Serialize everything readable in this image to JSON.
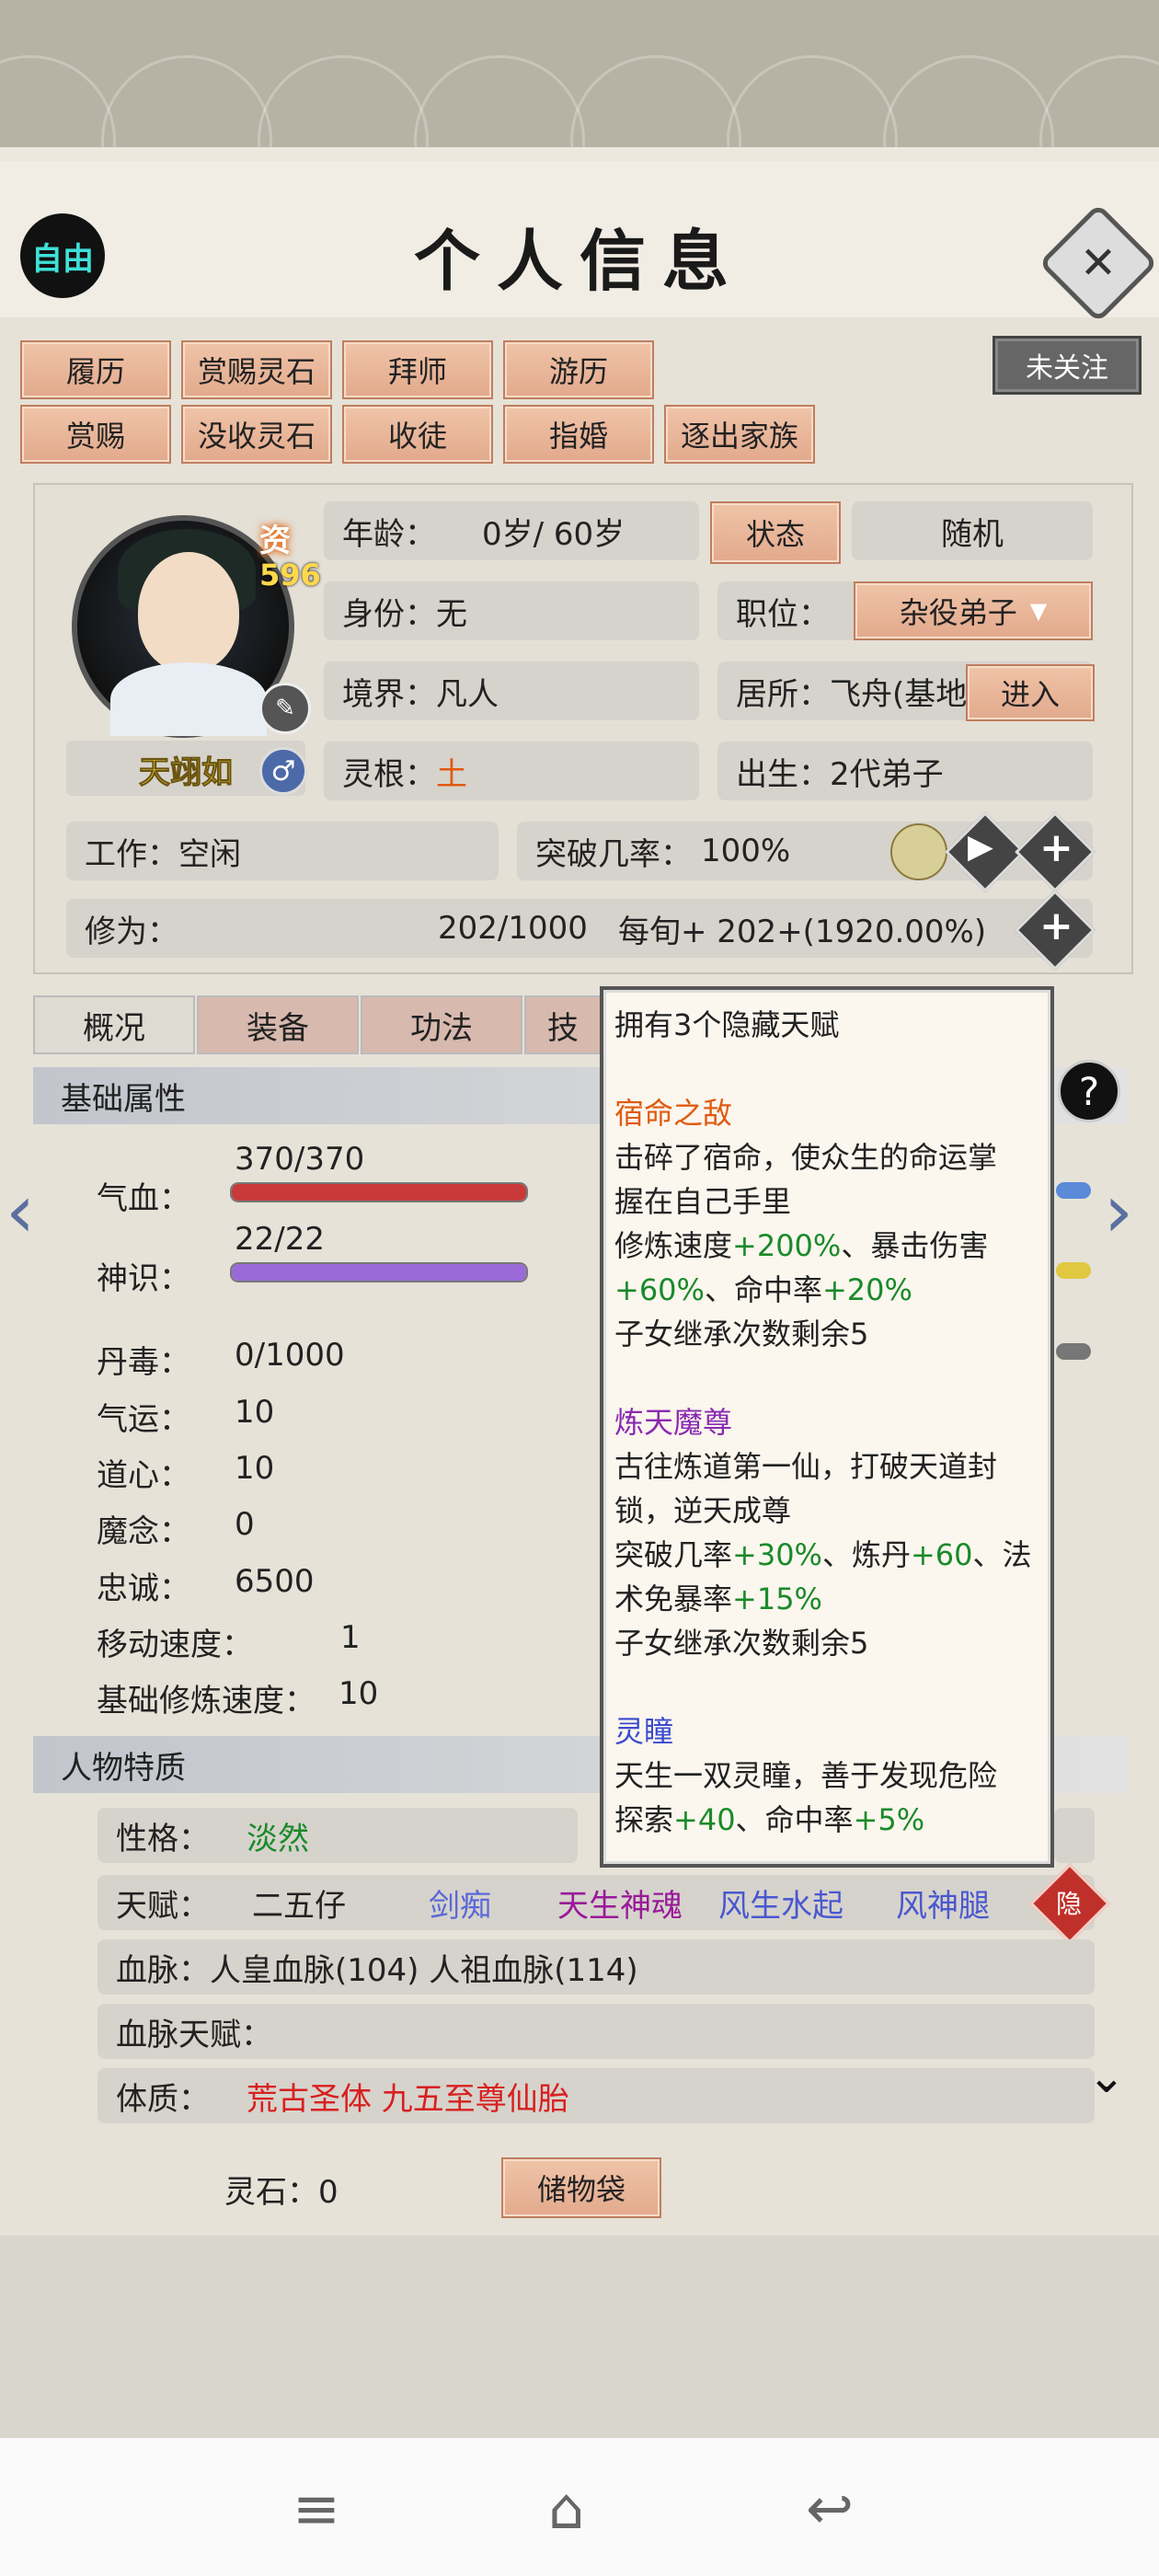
{
  "header": {
    "title": "个人信息",
    "free_badge": "自由",
    "close_icon": "✕"
  },
  "actions_row1": [
    "履历",
    "赏赐灵石",
    "拜师",
    "游历"
  ],
  "actions_row2": [
    "赏赐",
    "没收灵石",
    "收徒",
    "指婚",
    "逐出家族"
  ],
  "follow_button": "未关注",
  "character": {
    "name": "天翊如",
    "aptitude_label": "资",
    "aptitude_value": "596",
    "gender_icon": "♂",
    "age_label": "年龄：",
    "age_value": "0岁/ 60岁",
    "status_button": "状态",
    "random_button": "随机",
    "identity_label": "身份：",
    "identity_value": "无",
    "position_label": "职位：",
    "position_value": "杂役弟子",
    "realm_label": "境界：",
    "realm_value": "凡人",
    "residence_label": "居所：",
    "residence_value": "飞舟(基地",
    "enter_button": "进入",
    "root_label": "灵根：",
    "root_value": "土",
    "birth_label": "出生：",
    "birth_value": "2代弟子",
    "work_label": "工作：",
    "work_value": "空闲",
    "breakthrough_label": "突破几率：",
    "breakthrough_value": "100%",
    "cultivation_label": "修为：",
    "cultivation_value": "202/1000",
    "cultivation_rate": "每旬+   202+(1920.00%)"
  },
  "tabs": [
    "概况",
    "装备",
    "功法",
    "技"
  ],
  "basic": {
    "section_title": "基础属性",
    "hp_label": "气血：",
    "hp_value": "370/370",
    "hp_fraction": 1.0,
    "spirit_label": "神识：",
    "spirit_value": "22/22",
    "spirit_fraction": 1.0,
    "rows": [
      {
        "label": "丹毒：",
        "value": "0/1000"
      },
      {
        "label": "气运：",
        "value": "10"
      },
      {
        "label": "道心：",
        "value": "10"
      },
      {
        "label": "魔念：",
        "value": "0"
      },
      {
        "label": "忠诚：",
        "value": "6500"
      },
      {
        "label": "移动速度：",
        "value": "1"
      },
      {
        "label": "基础修炼速度：",
        "value": "10"
      }
    ]
  },
  "traits": {
    "section_title": "人物特质",
    "personality_label": "性格：",
    "personality_value": "淡然",
    "talent_label": "天赋：",
    "talents": [
      "二五仔",
      "剑痴",
      "天生神魂",
      "风生水起",
      "风神腿"
    ],
    "hidden_badge": "隐",
    "bloodline_label": "血脉：",
    "bloodline_value": "人皇血脉(104)   人祖血脉(114)",
    "bloodline_talent_label": "血脉天赋：",
    "physique_label": "体质：",
    "physique_value": "荒古圣体  九五至尊仙胎"
  },
  "tooltip": {
    "header": "拥有3个隐藏天赋",
    "t1_name": "宿命之敌",
    "t1_desc1": "击碎了宿命，使众生的命运掌",
    "t1_desc2": "握在自己手里",
    "t1_l3a": "修炼速度",
    "t1_l3b": "+200%",
    "t1_l3c": "、暴击伤害",
    "t1_l4a": "+60%",
    "t1_l4b": "、命中率",
    "t1_l4c": "+20%",
    "t1_inherit": "子女继承次数剩余5",
    "t2_name": "炼天魔尊",
    "t2_desc1": "古往炼道第一仙，打破天道封",
    "t2_desc2": "锁，逆天成尊",
    "t2_l3a": "突破几率",
    "t2_l3b": "+30%",
    "t2_l3c": "、炼丹",
    "t2_l3d": "+60",
    "t2_l3e": "、法",
    "t2_l4a": "术免暴率",
    "t2_l4b": "+15%",
    "t2_inherit": "子女继承次数剩余5",
    "t3_name": "灵瞳",
    "t3_desc1": "天生一双灵瞳，善于发现危险",
    "t3_l2a": "探索",
    "t3_l2b": "+40",
    "t3_l2c": "、命中率",
    "t3_l2d": "+5%"
  },
  "footer": {
    "spirit_stones": "灵石：0",
    "storage_button": "储物袋"
  },
  "colors": {
    "button_fill": "#e2a98c",
    "talent_red": "#e05a10",
    "talent_green": "#1a8a2a"
  }
}
